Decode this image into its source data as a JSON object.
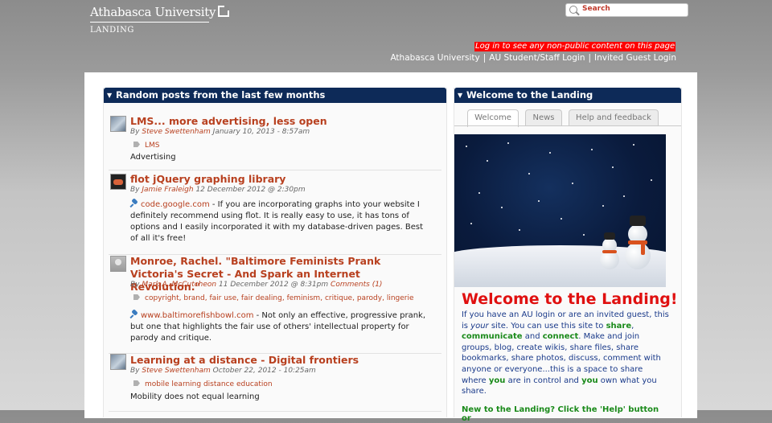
{
  "header": {
    "logo_text": "Athabasca University",
    "site_name": "LANDING",
    "search_placeholder": "Search",
    "login_notice": "Log in to see any non-public content on this page",
    "links": [
      "Athabasca University",
      "AU Student/Staff Login",
      "Invited Guest Login"
    ]
  },
  "left_panel": {
    "title": "Random posts from the last few months",
    "posts": [
      {
        "title": "LMS... more advertising, less open",
        "by": "By",
        "author": "Steve Swettenham",
        "date": "January 10, 2013 - 8:57am",
        "tags": [
          "LMS"
        ],
        "body": "Advertising"
      },
      {
        "title": "flot jQuery graphing library",
        "by": "By",
        "author": "Jamie Fraleigh",
        "date": "12 December 2012 @ 2:30pm",
        "link": "code.google.com",
        "body": " - If you are incorporating graphs into your website I definitely recommend using flot. It is really easy to use, it has tons of options and I easily incorporated it with my database-driven pages. Best of all it's free!"
      },
      {
        "title": "Monroe, Rachel. \"Baltimore Feminists Prank Victoria's Secret - And Spark an Internet Revolution.\"",
        "by": "By",
        "author": "Mark A. McCutcheon",
        "date": "11 December 2012 @ 8:31pm",
        "comments": "Comments (1)",
        "tags": [
          "copyright",
          "brand",
          "fair use",
          "fair dealing",
          "feminism",
          "critique",
          "parody",
          "lingerie"
        ],
        "link": "www.baltimorefishbowl.com",
        "body": " - Not only an effective, progressive prank, but one that highlights the fair use of others' intellectual property for parody and critique."
      },
      {
        "title": "Learning at a distance - Digital frontiers",
        "by": "By",
        "author": "Steve Swettenham",
        "date": "October 22, 2012 - 10:25am",
        "tags": [
          "mobile learning distance education"
        ],
        "body": "Mobility does not equal learning"
      }
    ]
  },
  "right_panel": {
    "title": "Welcome to the Landing",
    "tabs": [
      "Welcome",
      "News",
      "Help and feedback"
    ],
    "active_tab": "Welcome",
    "heading": "Welcome to the Landing!",
    "intro_1": "If you have an AU login or are an invited guest, this is ",
    "intro_your": "your",
    "intro_2": " site. You can use this site to ",
    "share": "share",
    "comma": ",",
    "communicate": "communicate",
    "and": " and ",
    "connect": "connect",
    "intro_3": ". Make and join groups, blog, create wikis, share files, share bookmarks, share photos, discuss, comment with anyone or everyone...this is a space to share where ",
    "you1": "you",
    "intro_4": " are in control and ",
    "you2": "you",
    "intro_5": " own what you share.",
    "next_line": "New to the Landing? Click the 'Help' button or"
  }
}
